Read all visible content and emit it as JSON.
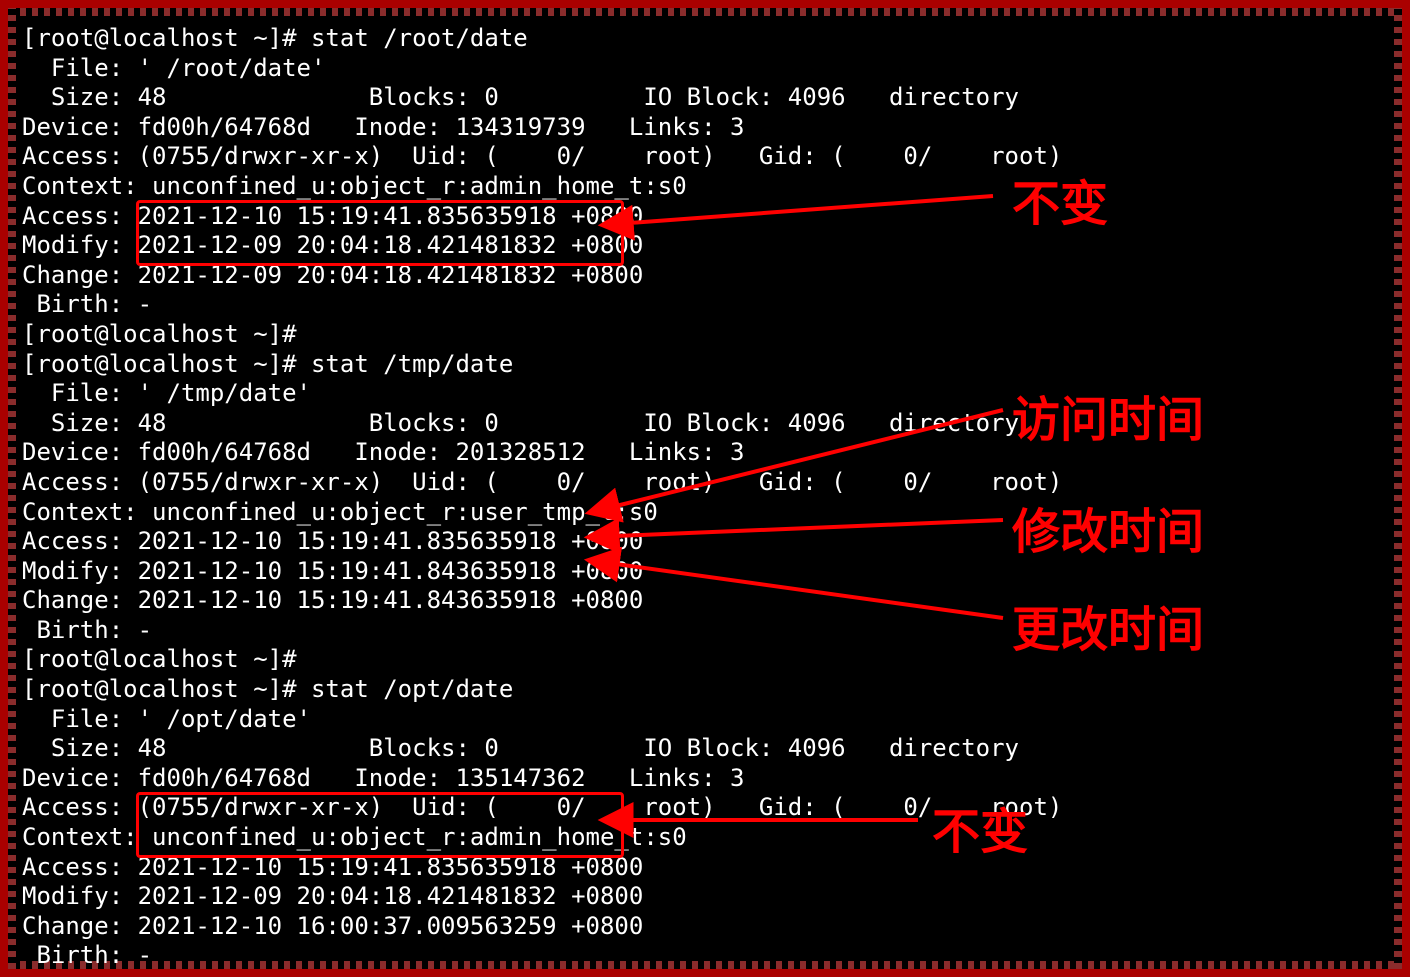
{
  "blocks": [
    {
      "prompt": "[root@localhost ~]# ",
      "cmd": "stat /root/date",
      "file": "  File: ' /root/date'",
      "size": "  Size: 48              Blocks: 0          IO Block: 4096   directory",
      "device": "Device: fd00h/64768d   Inode: 134319739   Links: 3",
      "perm": "Access: (0755/drwxr-xr-x)  Uid: (    0/    root)   Gid: (    0/    root)",
      "context": "Context: unconfined_u:object_r:admin_home_t:s0",
      "access": "Access: 2021-12-10 15:19:41.835635918 +0800",
      "modify": "Modify: 2021-12-09 20:04:18.421481832 +0800",
      "change": "Change: 2021-12-09 20:04:18.421481832 +0800",
      "birth": " Birth: -",
      "trail": "[root@localhost ~]#"
    },
    {
      "prompt": "[root@localhost ~]# ",
      "cmd": "stat /tmp/date",
      "file": "  File: ' /tmp/date'",
      "size": "  Size: 48              Blocks: 0          IO Block: 4096   directory",
      "device": "Device: fd00h/64768d   Inode: 201328512   Links: 3",
      "perm": "Access: (0755/drwxr-xr-x)  Uid: (    0/    root)   Gid: (    0/    root)",
      "context": "Context: unconfined_u:object_r:user_tmp_t:s0",
      "access": "Access: 2021-12-10 15:19:41.835635918 +0800",
      "modify": "Modify: 2021-12-10 15:19:41.843635918 +0800",
      "change": "Change: 2021-12-10 15:19:41.843635918 +0800",
      "birth": " Birth: -",
      "trail": "[root@localhost ~]#"
    },
    {
      "prompt": "[root@localhost ~]# ",
      "cmd": "stat /opt/date",
      "file": "  File: ' /opt/date'",
      "size": "  Size: 48              Blocks: 0          IO Block: 4096   directory",
      "device": "Device: fd00h/64768d   Inode: 135147362   Links: 3",
      "perm": "Access: (0755/drwxr-xr-x)  Uid: (    0/    root)   Gid: (    0/    root)",
      "context": "Context: unconfined_u:object_r:admin_home_t:s0",
      "access": "Access: 2021-12-10 15:19:41.835635918 +0800",
      "modify": "Modify: 2021-12-09 20:04:18.421481832 +0800",
      "change": "Change: 2021-12-10 16:00:37.009563259 +0800",
      "birth": " Birth: -",
      "trail": ""
    }
  ],
  "annotations": {
    "unchanged1": "不变",
    "atime": "访问时间",
    "mtime": "修改时间",
    "ctime": "更改时间",
    "unchanged2": "不变"
  }
}
